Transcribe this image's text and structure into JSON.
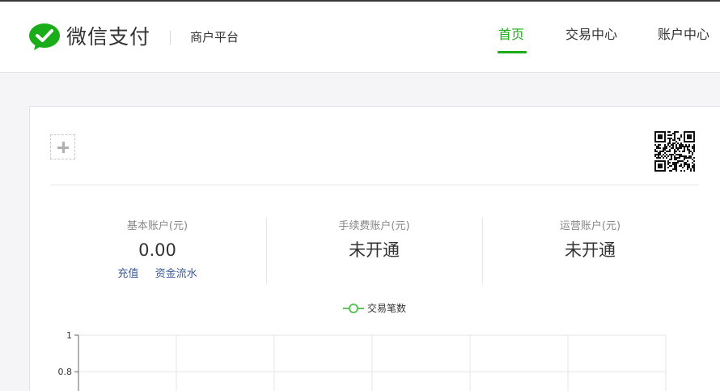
{
  "header": {
    "brand": "微信支付",
    "subtitle": "商户平台",
    "nav": [
      {
        "label": "首页",
        "active": true
      },
      {
        "label": "交易中心",
        "active": false
      },
      {
        "label": "账户中心",
        "active": false
      }
    ]
  },
  "accounts": [
    {
      "label": "基本账户(元)",
      "value": "0.00",
      "links": [
        "充值",
        "资金流水"
      ]
    },
    {
      "label": "手续费账户(元)",
      "value": "未开通"
    },
    {
      "label": "运营账户(元)",
      "value": "未开通"
    }
  ],
  "colors": {
    "accent": "#1aad19",
    "link": "#3a5b95",
    "line": "#5ec45c"
  },
  "icons": {
    "logo": "wechat-pay-logo-icon",
    "add": "plus-icon",
    "qr": "qr-code-icon"
  },
  "chart_data": {
    "type": "line",
    "series": [
      {
        "name": "交易笔数",
        "values": []
      }
    ],
    "y_ticks": [
      "1",
      "0.8"
    ],
    "ylim": [
      0,
      1
    ],
    "grid": true,
    "legend_position": "top-center"
  }
}
